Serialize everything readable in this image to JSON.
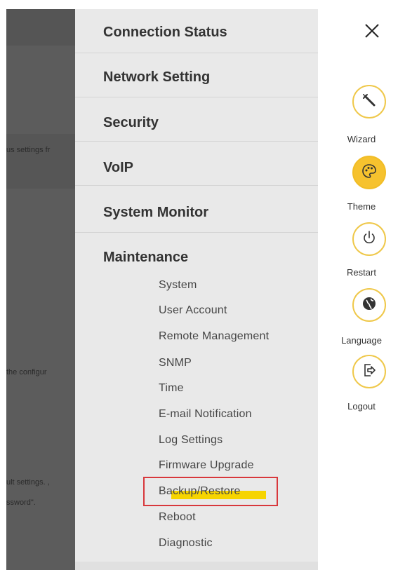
{
  "background_fragments": [
    "us settings fr",
    "the configur",
    "ult settings. ,",
    "ssword\"."
  ],
  "menu": {
    "items": [
      {
        "label": "Connection Status"
      },
      {
        "label": "Network Setting"
      },
      {
        "label": "Security"
      },
      {
        "label": "VoIP"
      },
      {
        "label": "System Monitor"
      },
      {
        "label": "Maintenance"
      }
    ],
    "maintenance_sub": [
      "System",
      "User Account",
      "Remote Management",
      "SNMP",
      "Time",
      "E-mail Notification",
      "Log Settings",
      "Firmware Upgrade",
      "Backup/Restore",
      "Reboot",
      "Diagnostic"
    ],
    "selected_sub": "Backup/Restore"
  },
  "side_actions": [
    {
      "label": "Wizard",
      "icon": "wand-icon"
    },
    {
      "label": "Theme",
      "icon": "palette-icon"
    },
    {
      "label": "Restart",
      "icon": "power-icon"
    },
    {
      "label": "Language",
      "icon": "globe-icon"
    },
    {
      "label": "Logout",
      "icon": "logout-icon"
    }
  ],
  "colors": {
    "accent": "#f6c22e",
    "highlight": "#f6d400",
    "callout_box": "#d8383c",
    "menu_bg": "#e9e9e9",
    "overlay_bg": "#5c5c5c"
  }
}
